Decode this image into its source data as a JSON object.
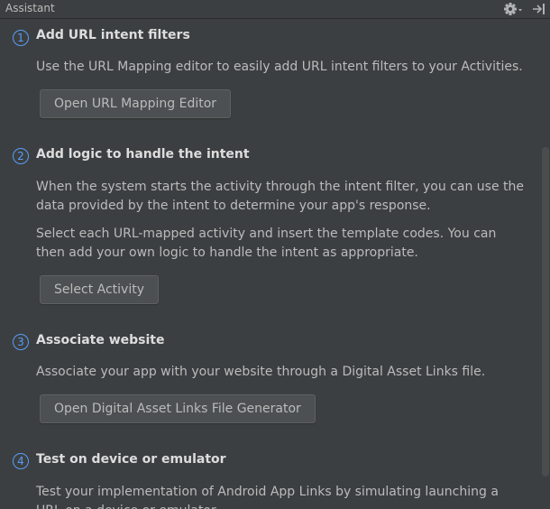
{
  "window": {
    "title": "Assistant",
    "gear_icon": "gear-icon",
    "hide_icon": "hide-panel-icon"
  },
  "colors": {
    "background": "#3c3f41",
    "accent": "#589df6",
    "button": "#4c5052",
    "scrollbar": "#4a4c4e"
  },
  "steps": [
    {
      "number": "1",
      "title": "Add URL intent filters",
      "paragraphs": [
        "Use the URL Mapping editor to easily add URL intent filters to your Activities."
      ],
      "button": "Open URL Mapping Editor"
    },
    {
      "number": "2",
      "title": "Add logic to handle the intent",
      "paragraphs": [
        "When the system starts the activity through the intent filter, you can use the data provided by the intent to determine your app's response.",
        "Select each URL-mapped activity and insert the template codes. You can then add your own logic to handle the intent as appropriate."
      ],
      "button": "Select Activity"
    },
    {
      "number": "3",
      "title": "Associate website",
      "paragraphs": [
        "Associate your app with your website through a Digital Asset Links file."
      ],
      "button": "Open Digital Asset Links File Generator"
    },
    {
      "number": "4",
      "title": "Test on device or emulator",
      "paragraphs": [
        "Test your implementation of Android App Links by simulating launching a URL on a device or emulator."
      ]
    }
  ]
}
